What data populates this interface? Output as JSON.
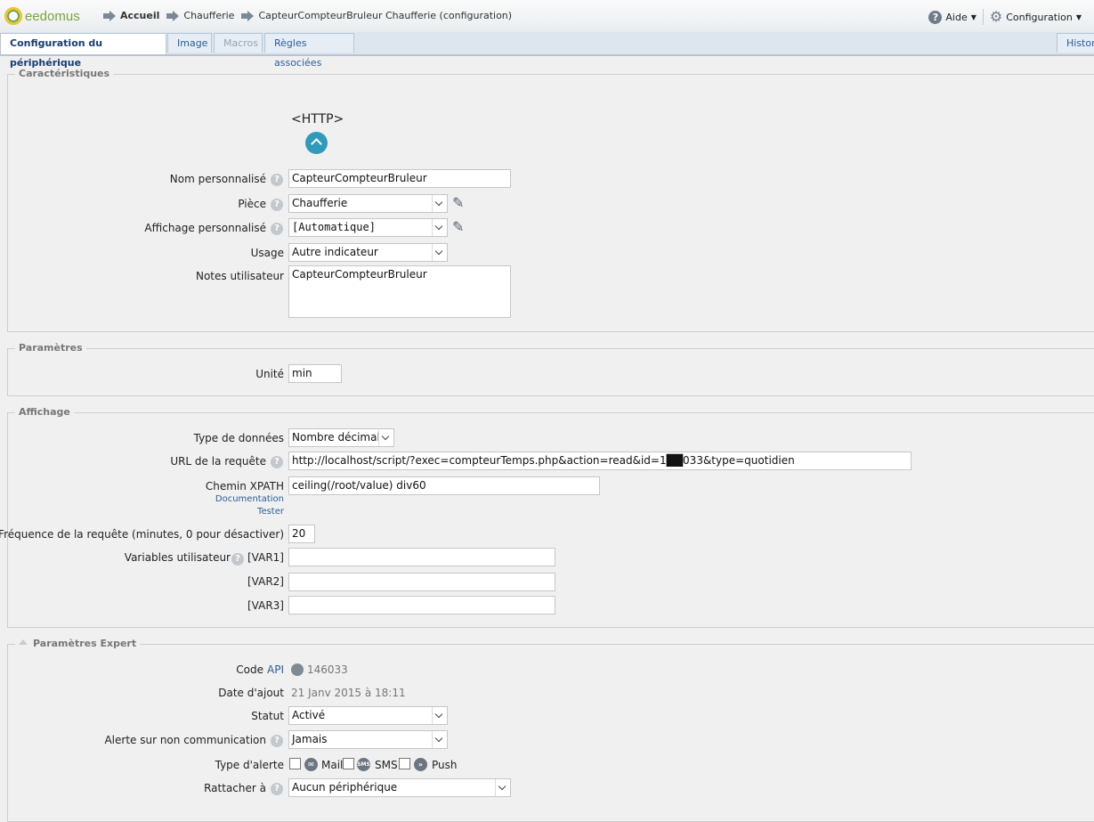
{
  "app": {
    "logo": "eedomus"
  },
  "breadcrumb": [
    "Accueil",
    "Chaufferie",
    "CapteurCompteurBruleur Chaufferie (configuration)"
  ],
  "header": {
    "help_label": "Aide",
    "config_label": "Configuration"
  },
  "tabs": {
    "config": "Configuration du périphérique",
    "image": "Image",
    "macros": "Macros",
    "rules": "Règles associées",
    "history": "Historiq"
  },
  "caracteristiques": {
    "legend": "Caractéristiques",
    "device_type": "<HTTP>",
    "nom_label": "Nom personnalisé",
    "nom_value": "CapteurCompteurBruleur",
    "piece_label": "Pièce",
    "piece_value": "Chaufferie",
    "affichage_label": "Affichage personnalisé",
    "affichage_value": "[Automatique]",
    "usage_label": "Usage",
    "usage_value": "Autre indicateur",
    "notes_label": "Notes utilisateur",
    "notes_value": "CapteurCompteurBruleur"
  },
  "parametres": {
    "legend": "Paramètres",
    "unite_label": "Unité",
    "unite_value": "min"
  },
  "affichage": {
    "legend": "Affichage",
    "type_label": "Type de données",
    "type_value": "Nombre décimal",
    "url_label": "URL de la requête",
    "url_value": "http://localhost/script/?exec=compteurTemps.php&action=read&id=1██033&type=quotidien",
    "xpath_label": "Chemin XPATH",
    "xpath_value": "ceiling(/root/value) div60",
    "doc_link": "Documentation",
    "test_link": "Tester",
    "freq_label": "Fréquence de la requête (minutes, 0 pour désactiver)",
    "freq_value": "20",
    "vars_label": "Variables utilisateur",
    "var1_label": "[VAR1]",
    "var2_label": "[VAR2]",
    "var3_label": "[VAR3]",
    "var1_value": "",
    "var2_value": "",
    "var3_value": ""
  },
  "expert": {
    "legend": "Paramètres Expert",
    "code_label": "Code",
    "api_link": "API",
    "code_value": "146033",
    "date_label": "Date d'ajout",
    "date_value": "21 Janv 2015 à 18:11",
    "statut_label": "Statut",
    "statut_value": "Activé",
    "alerte_label": "Alerte sur non communication",
    "alerte_value": "Jamais",
    "type_alerte_label": "Type d'alerte",
    "mail_label": "Mail",
    "sms_label": "SMS",
    "push_label": "Push",
    "sms_icon_text": "SMS",
    "rattacher_label": "Rattacher à",
    "rattacher_value": "Aucun périphérique"
  }
}
